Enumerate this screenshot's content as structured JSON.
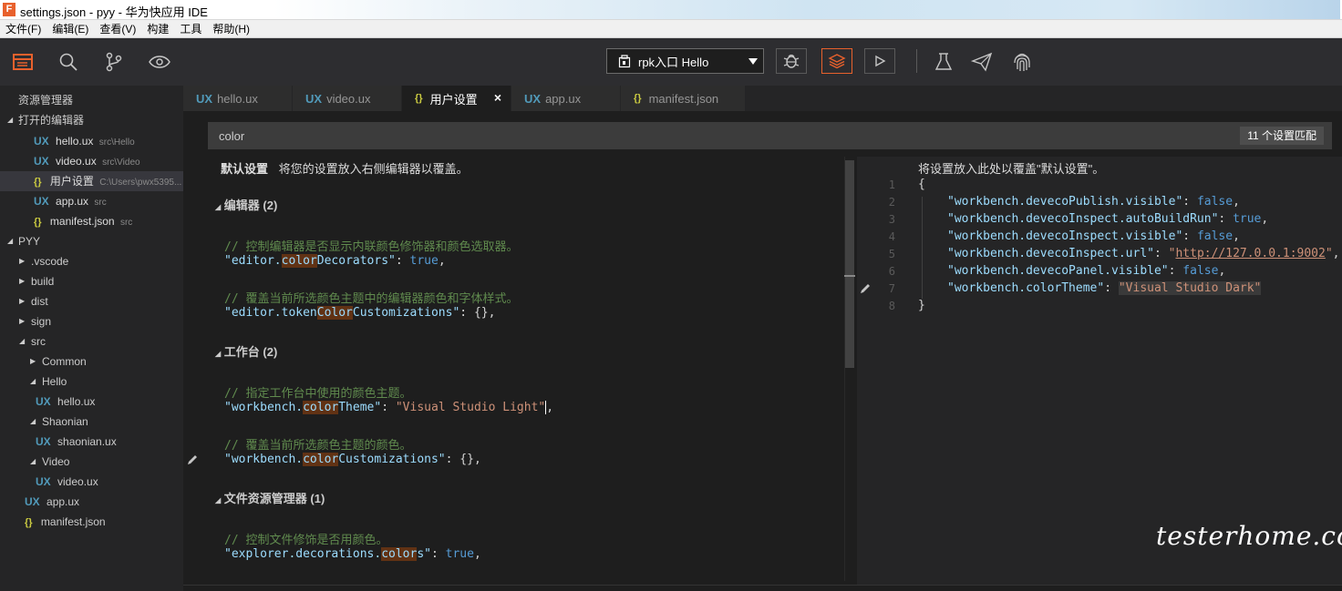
{
  "window": {
    "title": "settings.json - pyy - 华为快应用 IDE",
    "app_icon_letter": "F"
  },
  "menu": [
    "文件(F)",
    "编辑(E)",
    "查看(V)",
    "构建",
    "工具",
    "帮助(H)"
  ],
  "toolbar": {
    "run_target": "rpk入口 Hello"
  },
  "explorer": {
    "title": "资源管理器",
    "open_editors_header": "打开的编辑器",
    "open_editors": [
      {
        "icon": "UX",
        "name": "hello.ux",
        "desc": "src\\Hello"
      },
      {
        "icon": "UX",
        "name": "video.ux",
        "desc": "src\\Video"
      },
      {
        "icon": "{}",
        "name": "用户设置",
        "desc": "C:\\Users\\pwx5395..."
      },
      {
        "icon": "UX",
        "name": "app.ux",
        "desc": "src"
      },
      {
        "icon": "{}",
        "name": "manifest.json",
        "desc": "src"
      }
    ],
    "project_header": "PYY",
    "tree": [
      ".vscode",
      "build",
      "dist",
      "sign",
      "src",
      "Common",
      "Hello",
      "hello.ux",
      "Shaonian",
      "shaonian.ux",
      "Video",
      "video.ux",
      "app.ux",
      "manifest.json"
    ]
  },
  "tabs": [
    {
      "icon": "UX",
      "label": "hello.ux"
    },
    {
      "icon": "UX",
      "label": "video.ux"
    },
    {
      "icon": "{}",
      "label": "用户设置",
      "active": true,
      "close": "×"
    },
    {
      "icon": "UX",
      "label": "app.ux"
    },
    {
      "icon": "{}",
      "label": "manifest.json"
    }
  ],
  "search": {
    "value": "color",
    "match_count": "11 个设置匹配"
  },
  "default_settings": {
    "title": "默认设置",
    "hint": "将您的设置放入右侧编辑器以覆盖。",
    "sections": [
      {
        "title": "编辑器 (2)",
        "items": [
          {
            "comment": "// 控制编辑器是否显示内联颜色修饰器和颜色选取器。",
            "key_pre": "\"editor.",
            "key_hl": "color",
            "key_post": "Decorators\"",
            "sep": ": ",
            "value": "true",
            "end": ","
          },
          {
            "comment": "// 覆盖当前所选颜色主题中的编辑器颜色和字体样式。",
            "key_pre": "\"editor.token",
            "key_hl": "Color",
            "key_post": "Customizations\"",
            "sep": ": ",
            "value": "{}",
            "end": ","
          }
        ]
      },
      {
        "title": "工作台 (2)",
        "items": [
          {
            "comment": "// 指定工作台中使用的颜色主题。",
            "key_pre": "\"workbench.",
            "key_hl": "color",
            "key_post": "Theme\"",
            "sep": ": ",
            "value": "\"Visual Studio Light\"",
            "end": ","
          },
          {
            "comment": "// 覆盖当前所选颜色主题的颜色。",
            "key_pre": "\"workbench.",
            "key_hl": "color",
            "key_post": "Customizations\"",
            "sep": ": ",
            "value": "{}",
            "end": ","
          }
        ]
      },
      {
        "title": "文件资源管理器 (1)",
        "items": [
          {
            "comment": "// 控制文件修饰是否用颜色。",
            "key_pre": "\"explorer.decorations.",
            "key_hl": "color",
            "key_post": "s\"",
            "sep": ": ",
            "value": "true",
            "end": ","
          }
        ]
      }
    ]
  },
  "user_settings": {
    "hint": "将设置放入此处以覆盖\"默认设置\"。",
    "line_numbers": [
      "1",
      "2",
      "3",
      "4",
      "5",
      "6",
      "7",
      "8"
    ],
    "open_brace": "{",
    "close_brace": "}",
    "entries": [
      {
        "key": "\"workbench.devecoPublish.visible\"",
        "value": "false",
        "end": ","
      },
      {
        "key": "\"workbench.devecoInspect.autoBuildRun\"",
        "value": "true",
        "end": ","
      },
      {
        "key": "\"workbench.devecoInspect.visible\"",
        "value": "false",
        "end": ","
      },
      {
        "key": "\"workbench.devecoInspect.url\"",
        "value": "http://127.0.0.1:9002",
        "end": ","
      },
      {
        "key": "\"workbench.devecoPanel.visible\"",
        "value": "false",
        "end": ","
      },
      {
        "key": "\"workbench.colorTheme\"",
        "value": "\"Visual Studio Dark\"",
        "end": ""
      }
    ]
  },
  "watermark": "testerhome.com",
  "colors": {
    "accent": "#e8612c",
    "ux_icon": "#519aba",
    "json_icon": "#cbcb41",
    "comment": "#608b4e",
    "key": "#9cdcfe",
    "bool": "#569cd6",
    "string": "#ce9178",
    "match_highlight": "#613214"
  }
}
